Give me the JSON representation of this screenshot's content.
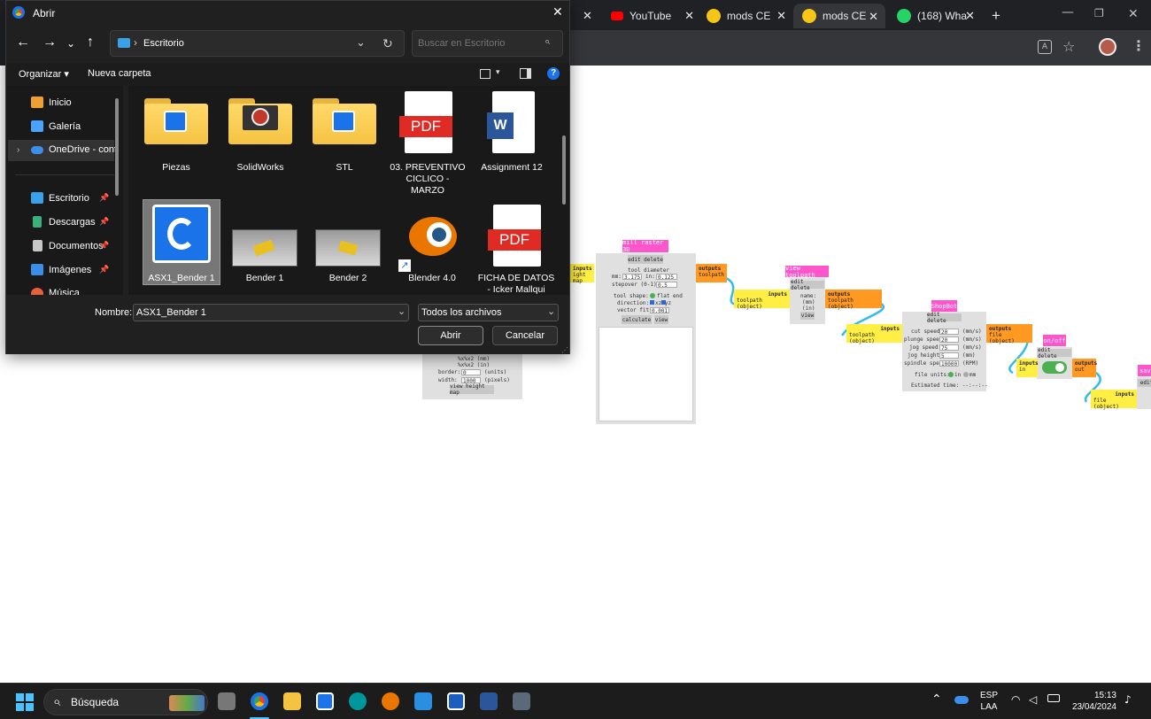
{
  "browser": {
    "tabs": [
      {
        "label": "YouTube",
        "icon": "youtube-icon",
        "color": "#ff0000"
      },
      {
        "label": "mods CE",
        "icon": "emoji-sunglasses-icon",
        "color": "#f5c518"
      },
      {
        "label": "mods CE",
        "icon": "emoji-sunglasses-icon",
        "color": "#f5c518",
        "active": true
      },
      {
        "label": "(168) Wha",
        "icon": "whatsapp-icon",
        "color": "#25d366"
      }
    ],
    "new_tab": "+",
    "close_glyph": "✕"
  },
  "mods": {
    "mill_raster": {
      "title": "mill raster 3D",
      "actions": "edit delete",
      "inputs": "inputs",
      "inputs_item": "ight map",
      "tool_diameter": "tool diameter",
      "mm_label": "mm:",
      "mm_value": "3.175",
      "in_label": "in:",
      "in_value": "0.125",
      "stepover_label": "stepover (0-1):",
      "stepover_value": "0.5",
      "tool_shape_label": "tool shape:",
      "tool_shape_value": "flat end",
      "direction_label": "direction:",
      "direction_value": "xz yz",
      "vector_fit_label": "vector fit:",
      "vector_fit_value": "0.001",
      "calculate": "calculate",
      "view": "view",
      "outputs": "outputs",
      "outputs_item": "toolpath"
    },
    "left_module": {
      "line1": "%x%x2 (mm)",
      "line2": "%x%x2 (in)",
      "border_label": "border:",
      "border_value": "0",
      "border_unit": "(units)",
      "width_label": "width:",
      "width_value": "1000",
      "width_unit": "(pixels)",
      "button": "view height map"
    },
    "view_toolpath": {
      "title": "view toolpath",
      "actions": "edit delete",
      "inputs": "inputs",
      "inputs_item": "toolpath (object)",
      "name_label": "name:",
      "name_mm": "(mm)",
      "name_in": "(in)",
      "view": "view",
      "outputs": "outputs",
      "outputs_item": "toolpath (object)"
    },
    "shopbot": {
      "title": "ShopBot",
      "actions": "edit delete",
      "inputs": "inputs",
      "inputs_item": "toolpath (object)",
      "cut_speed_label": "cut speed:",
      "cut_speed_value": "20",
      "cut_speed_unit": "(mm/s)",
      "plunge_label": "plunge speed:",
      "plunge_value": "20",
      "plunge_unit": "(mm/s)",
      "jog_speed_label": "jog speed:",
      "jog_speed_value": "75",
      "jog_speed_unit": "(mm/s)",
      "jog_height_label": "jog height:",
      "jog_height_value": "5",
      "jog_height_unit": "(mm)",
      "spindle_label": "spindle speed:",
      "spindle_value": "10000",
      "spindle_unit": "(RPM)",
      "file_units_label": "file units:",
      "file_units_in": "in",
      "file_units_mm": "mm",
      "estimated": "Estimated time: --:--:--",
      "outputs": "outputs",
      "outputs_item": "file (object)"
    },
    "onoff": {
      "title": "on/off",
      "actions": "edit delete",
      "inputs": "inputs",
      "inputs_item": "in",
      "outputs": "outputs",
      "outputs_item": "out"
    },
    "save": {
      "inputs": "inputs",
      "inputs_item": "file (object)",
      "title": "sav",
      "actions": "edit"
    }
  },
  "dialog": {
    "title": "Abrir",
    "breadcrumb": "Escritorio",
    "search_placeholder": "Buscar en Escritorio",
    "organize": "Organizar",
    "new_folder": "Nueva carpeta",
    "nav": [
      {
        "label": "Inicio",
        "icon": "home-icon",
        "color": "#f0a030"
      },
      {
        "label": "Galería",
        "icon": "gallery-icon",
        "color": "#4aa3ff"
      },
      {
        "label": "OneDrive - cont",
        "icon": "onedrive-icon",
        "color": "#3b8eea"
      },
      {
        "label": "Escritorio",
        "icon": "desktop-icon",
        "color": "#3aa0e8"
      },
      {
        "label": "Descargas",
        "icon": "download-icon",
        "color": "#3ab07a"
      },
      {
        "label": "Documentos",
        "icon": "documents-icon",
        "color": "#c8c8c8"
      },
      {
        "label": "Imágenes",
        "icon": "pictures-icon",
        "color": "#3a8ee8"
      },
      {
        "label": "Música",
        "icon": "music-icon",
        "color": "#e8603a"
      }
    ],
    "files": [
      {
        "name": "Piezas",
        "kind": "folder"
      },
      {
        "name": "SolidWorks",
        "kind": "folder"
      },
      {
        "name": "STL",
        "kind": "folder"
      },
      {
        "name": "03. PREVENTIVO CICLICO - MARZO",
        "kind": "pdf"
      },
      {
        "name": "Assignment 12",
        "kind": "word"
      },
      {
        "name": "ASX1_Bender 1",
        "kind": "app",
        "selected": true
      },
      {
        "name": "Bender 1",
        "kind": "image"
      },
      {
        "name": "Bender 2",
        "kind": "image"
      },
      {
        "name": "Blender 4.0",
        "kind": "shortcut"
      },
      {
        "name": "FICHA DE DATOS - Icker Mallqui",
        "kind": "pdf"
      }
    ],
    "pdf_badge": "PDF",
    "word_badge": "W",
    "name_label": "Nombre:",
    "name_value": "ASX1_Bender 1",
    "filter_value": "Todos los archivos",
    "open": "Abrir",
    "cancel": "Cancelar",
    "help": "?"
  },
  "taskbar": {
    "search": "Búsqueda",
    "lang1": "ESP",
    "lang2": "LAA",
    "time": "15:13",
    "date": "23/04/2024"
  }
}
